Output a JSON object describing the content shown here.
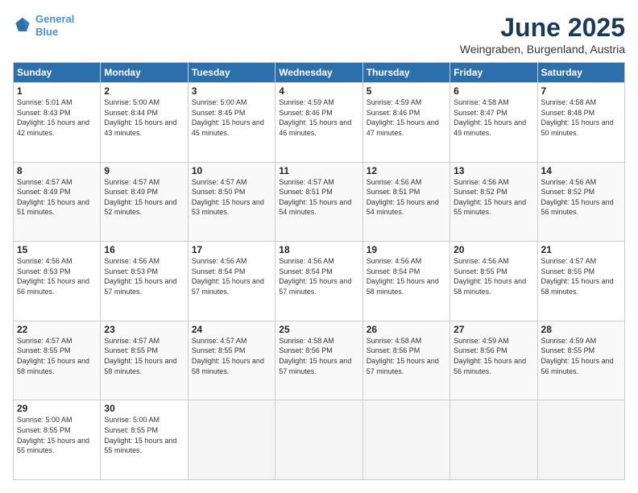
{
  "logo": {
    "line1": "General",
    "line2": "Blue"
  },
  "title": "June 2025",
  "location": "Weingraben, Burgenland, Austria",
  "headers": [
    "Sunday",
    "Monday",
    "Tuesday",
    "Wednesday",
    "Thursday",
    "Friday",
    "Saturday"
  ],
  "weeks": [
    [
      {
        "num": "1",
        "rise": "5:01 AM",
        "set": "8:43 PM",
        "daylight": "15 hours and 42 minutes."
      },
      {
        "num": "2",
        "rise": "5:00 AM",
        "set": "8:44 PM",
        "daylight": "15 hours and 43 minutes."
      },
      {
        "num": "3",
        "rise": "5:00 AM",
        "set": "8:45 PM",
        "daylight": "15 hours and 45 minutes."
      },
      {
        "num": "4",
        "rise": "4:59 AM",
        "set": "8:46 PM",
        "daylight": "15 hours and 46 minutes."
      },
      {
        "num": "5",
        "rise": "4:59 AM",
        "set": "8:46 PM",
        "daylight": "15 hours and 47 minutes."
      },
      {
        "num": "6",
        "rise": "4:58 AM",
        "set": "8:47 PM",
        "daylight": "15 hours and 49 minutes."
      },
      {
        "num": "7",
        "rise": "4:58 AM",
        "set": "8:48 PM",
        "daylight": "15 hours and 50 minutes."
      }
    ],
    [
      {
        "num": "8",
        "rise": "4:57 AM",
        "set": "8:49 PM",
        "daylight": "15 hours and 51 minutes."
      },
      {
        "num": "9",
        "rise": "4:57 AM",
        "set": "8:49 PM",
        "daylight": "15 hours and 52 minutes."
      },
      {
        "num": "10",
        "rise": "4:57 AM",
        "set": "8:50 PM",
        "daylight": "15 hours and 53 minutes."
      },
      {
        "num": "11",
        "rise": "4:57 AM",
        "set": "8:51 PM",
        "daylight": "15 hours and 54 minutes."
      },
      {
        "num": "12",
        "rise": "4:56 AM",
        "set": "8:51 PM",
        "daylight": "15 hours and 54 minutes."
      },
      {
        "num": "13",
        "rise": "4:56 AM",
        "set": "8:52 PM",
        "daylight": "15 hours and 55 minutes."
      },
      {
        "num": "14",
        "rise": "4:56 AM",
        "set": "8:52 PM",
        "daylight": "15 hours and 56 minutes."
      }
    ],
    [
      {
        "num": "15",
        "rise": "4:56 AM",
        "set": "8:53 PM",
        "daylight": "15 hours and 56 minutes."
      },
      {
        "num": "16",
        "rise": "4:56 AM",
        "set": "8:53 PM",
        "daylight": "15 hours and 57 minutes."
      },
      {
        "num": "17",
        "rise": "4:56 AM",
        "set": "8:54 PM",
        "daylight": "15 hours and 57 minutes."
      },
      {
        "num": "18",
        "rise": "4:56 AM",
        "set": "8:54 PM",
        "daylight": "15 hours and 57 minutes."
      },
      {
        "num": "19",
        "rise": "4:56 AM",
        "set": "8:54 PM",
        "daylight": "15 hours and 58 minutes."
      },
      {
        "num": "20",
        "rise": "4:56 AM",
        "set": "8:55 PM",
        "daylight": "15 hours and 58 minutes."
      },
      {
        "num": "21",
        "rise": "4:57 AM",
        "set": "8:55 PM",
        "daylight": "15 hours and 58 minutes."
      }
    ],
    [
      {
        "num": "22",
        "rise": "4:57 AM",
        "set": "8:55 PM",
        "daylight": "15 hours and 58 minutes."
      },
      {
        "num": "23",
        "rise": "4:57 AM",
        "set": "8:55 PM",
        "daylight": "15 hours and 58 minutes."
      },
      {
        "num": "24",
        "rise": "4:57 AM",
        "set": "8:55 PM",
        "daylight": "15 hours and 58 minutes."
      },
      {
        "num": "25",
        "rise": "4:58 AM",
        "set": "8:56 PM",
        "daylight": "15 hours and 57 minutes."
      },
      {
        "num": "26",
        "rise": "4:58 AM",
        "set": "8:56 PM",
        "daylight": "15 hours and 57 minutes."
      },
      {
        "num": "27",
        "rise": "4:59 AM",
        "set": "8:56 PM",
        "daylight": "15 hours and 56 minutes."
      },
      {
        "num": "28",
        "rise": "4:59 AM",
        "set": "8:55 PM",
        "daylight": "15 hours and 56 minutes."
      }
    ],
    [
      {
        "num": "29",
        "rise": "5:00 AM",
        "set": "8:55 PM",
        "daylight": "15 hours and 55 minutes."
      },
      {
        "num": "30",
        "rise": "5:00 AM",
        "set": "8:55 PM",
        "daylight": "15 hours and 55 minutes."
      },
      null,
      null,
      null,
      null,
      null
    ]
  ]
}
